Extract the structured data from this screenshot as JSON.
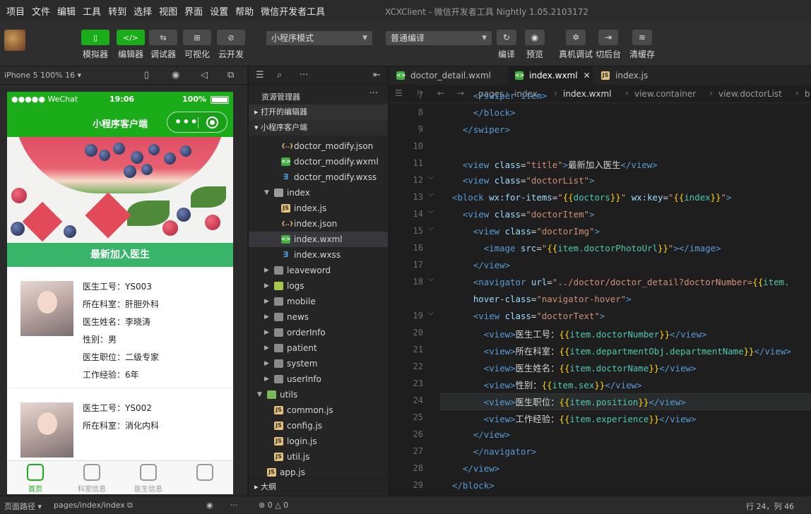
{
  "menu": [
    "项目",
    "文件",
    "编辑",
    "工具",
    "转到",
    "选择",
    "视图",
    "界面",
    "设置",
    "帮助",
    "微信开发者工具"
  ],
  "window_title": "XCXClient - 微信开发者工具 Nightly 1.05.2103172",
  "toolbar": {
    "buttons": [
      {
        "label": "模拟器",
        "icon": "phone-icon"
      },
      {
        "label": "编辑器",
        "icon": "code-icon"
      },
      {
        "label": "调试器",
        "icon": "debug-icon"
      },
      {
        "label": "可视化",
        "icon": "layout-icon"
      },
      {
        "label": "云开发",
        "icon": "cloud-icon"
      }
    ],
    "mode_select": "小程序模式",
    "compile_select": "普通编译",
    "right_buttons": [
      {
        "label": "编译",
        "icon": "refresh-icon"
      },
      {
        "label": "预览",
        "icon": "eye-icon"
      },
      {
        "label": "真机调试",
        "icon": "bug-icon"
      },
      {
        "label": "切后台",
        "icon": "switch-icon"
      },
      {
        "label": "清缓存",
        "icon": "layers-icon"
      }
    ]
  },
  "simulator": {
    "device": "iPhone 5 100% 16 ▾",
    "status": {
      "carrier": "●●●●● WeChat",
      "time": "19:06",
      "battery": "100%"
    },
    "nav_title": "小程序客户端",
    "section_title": "最新加入医生",
    "doctors": [
      {
        "lines": [
          "医生工号：YS003",
          "所在科室：肝胆外科",
          "医生姓名：李晓涛",
          "性别：男",
          "医生职位：二级专家",
          "工作经验：6年"
        ]
      },
      {
        "lines": [
          "医生工号：YS002",
          "所在科室：消化内科"
        ]
      }
    ],
    "tabs": [
      "首页",
      "科室信息",
      "医生信息",
      ""
    ]
  },
  "explorer": {
    "title": "资源管理器",
    "section_open": "打开的编辑器",
    "section_project": "小程序客户端",
    "items": [
      {
        "name": "doctor_modify.json",
        "type": "json",
        "indent": 2
      },
      {
        "name": "doctor_modify.wxml",
        "type": "wxml",
        "indent": 2
      },
      {
        "name": "doctor_modify.wxss",
        "type": "wxss",
        "indent": 2
      },
      {
        "name": "index",
        "type": "folder-open",
        "indent": 1
      },
      {
        "name": "index.js",
        "type": "js",
        "indent": 2
      },
      {
        "name": "index.json",
        "type": "json",
        "indent": 2
      },
      {
        "name": "index.wxml",
        "type": "wxml",
        "indent": 2,
        "selected": true
      },
      {
        "name": "index.wxss",
        "type": "wxss",
        "indent": 2
      },
      {
        "name": "leaveword",
        "type": "folder",
        "indent": 1
      },
      {
        "name": "logs",
        "type": "logsfolder",
        "indent": 1
      },
      {
        "name": "mobile",
        "type": "folder",
        "indent": 1
      },
      {
        "name": "news",
        "type": "folder",
        "indent": 1
      },
      {
        "name": "orderInfo",
        "type": "folder",
        "indent": 1
      },
      {
        "name": "patient",
        "type": "folder",
        "indent": 1
      },
      {
        "name": "system",
        "type": "folder",
        "indent": 1
      },
      {
        "name": "userInfo",
        "type": "folder",
        "indent": 1
      },
      {
        "name": "utils",
        "type": "utils-open",
        "indent": 0
      },
      {
        "name": "common.js",
        "type": "js",
        "indent": 1
      },
      {
        "name": "config.js",
        "type": "js",
        "indent": 1
      },
      {
        "name": "login.js",
        "type": "js",
        "indent": 1
      },
      {
        "name": "util.js",
        "type": "js",
        "indent": 1
      },
      {
        "name": "app.js",
        "type": "js",
        "indent": 0
      }
    ],
    "outline": "大纲"
  },
  "editor": {
    "tabs": [
      {
        "name": "doctor_detail.wxml",
        "type": "wxml"
      },
      {
        "name": "index.wxml",
        "type": "wxml",
        "active": true
      },
      {
        "name": "index.js",
        "type": "js"
      }
    ],
    "breadcrumb": [
      "pages",
      "index",
      "index.wxml",
      "view.container",
      "view.doctorList",
      "b"
    ],
    "current_line": 24,
    "lines": [
      {
        "n": 7,
        "tokens": [
          [
            "tx",
            "    "
          ],
          [
            "tg",
            "</swiper-item>"
          ]
        ]
      },
      {
        "n": 8,
        "tokens": [
          [
            "tx",
            "    "
          ],
          [
            "tg",
            "</block>"
          ]
        ]
      },
      {
        "n": 9,
        "tokens": [
          [
            "tx",
            "  "
          ],
          [
            "tg",
            "</swiper>"
          ]
        ]
      },
      {
        "n": 10,
        "tokens": []
      },
      {
        "n": 11,
        "tokens": [
          [
            "tx",
            "  "
          ],
          [
            "tg",
            "<view "
          ],
          [
            "at",
            "class"
          ],
          [
            "tx",
            "="
          ],
          [
            "sv",
            "\"title\""
          ],
          [
            "tg",
            ">"
          ],
          [
            "tx",
            "最新加入医生"
          ],
          [
            "tg",
            "</view>"
          ]
        ]
      },
      {
        "n": 12,
        "fold": true,
        "tokens": [
          [
            "tx",
            "  "
          ],
          [
            "tg",
            "<view "
          ],
          [
            "at",
            "class"
          ],
          [
            "tx",
            "="
          ],
          [
            "sv",
            "\"doctorList\""
          ],
          [
            "tg",
            ">"
          ]
        ]
      },
      {
        "n": 13,
        "fold": true,
        "tokens": [
          [
            "tg",
            "<block "
          ],
          [
            "at",
            "wx:for-items"
          ],
          [
            "tx",
            "="
          ],
          [
            "sv",
            "\""
          ],
          [
            "br",
            "{{"
          ],
          [
            "vr",
            "doctors"
          ],
          [
            "br",
            "}}"
          ],
          [
            "sv",
            "\""
          ],
          [
            "tx",
            " "
          ],
          [
            "at",
            "wx:key"
          ],
          [
            "tx",
            "="
          ],
          [
            "sv",
            "\""
          ],
          [
            "br",
            "{{"
          ],
          [
            "vr",
            "index"
          ],
          [
            "br",
            "}}"
          ],
          [
            "sv",
            "\""
          ],
          [
            "tg",
            ">"
          ]
        ]
      },
      {
        "n": 14,
        "fold": true,
        "tokens": [
          [
            "tx",
            "  "
          ],
          [
            "tg",
            "<view "
          ],
          [
            "at",
            "class"
          ],
          [
            "tx",
            "="
          ],
          [
            "sv",
            "\"doctorItem\""
          ],
          [
            "tg",
            ">"
          ]
        ]
      },
      {
        "n": 15,
        "fold": true,
        "tokens": [
          [
            "tx",
            "    "
          ],
          [
            "tg",
            "<view "
          ],
          [
            "at",
            "class"
          ],
          [
            "tx",
            "="
          ],
          [
            "sv",
            "\"doctorImg\""
          ],
          [
            "tg",
            ">"
          ]
        ]
      },
      {
        "n": 16,
        "tokens": [
          [
            "tx",
            "      "
          ],
          [
            "tg",
            "<image "
          ],
          [
            "at",
            "src"
          ],
          [
            "tx",
            "="
          ],
          [
            "sv",
            "\""
          ],
          [
            "br",
            "{{"
          ],
          [
            "vr",
            "item.doctorPhotoUrl"
          ],
          [
            "br",
            "}}"
          ],
          [
            "sv",
            "\""
          ],
          [
            "tg",
            "></image>"
          ]
        ]
      },
      {
        "n": 17,
        "tokens": [
          [
            "tx",
            "    "
          ],
          [
            "tg",
            "</view>"
          ]
        ]
      },
      {
        "n": 18,
        "fold": true,
        "tokens": [
          [
            "tx",
            "    "
          ],
          [
            "tg",
            "<navigator "
          ],
          [
            "at",
            "url"
          ],
          [
            "tx",
            "="
          ],
          [
            "sv",
            "\"../doctor/doctor_detail?doctorNumber="
          ],
          [
            "br",
            "{{"
          ],
          [
            "vr",
            "item."
          ]
        ]
      },
      {
        "n": 0,
        "tokens": [
          [
            "tx",
            "    "
          ],
          [
            "at",
            "hover-class"
          ],
          [
            "tx",
            "="
          ],
          [
            "sv",
            "\"navigator-hover\""
          ],
          [
            "tg",
            ">"
          ]
        ]
      },
      {
        "n": 19,
        "fold": true,
        "tokens": [
          [
            "tx",
            "    "
          ],
          [
            "tg",
            "<view "
          ],
          [
            "at",
            "class"
          ],
          [
            "tx",
            "="
          ],
          [
            "sv",
            "\"doctorText\""
          ],
          [
            "tg",
            ">"
          ]
        ]
      },
      {
        "n": 20,
        "tokens": [
          [
            "tx",
            "      "
          ],
          [
            "tg",
            "<view>"
          ],
          [
            "tx",
            "医生工号："
          ],
          [
            "br",
            "{{"
          ],
          [
            "vr",
            "item.doctorNumber"
          ],
          [
            "br",
            "}}"
          ],
          [
            "tg",
            "</view>"
          ]
        ]
      },
      {
        "n": 21,
        "tokens": [
          [
            "tx",
            "      "
          ],
          [
            "tg",
            "<view>"
          ],
          [
            "tx",
            "所在科室："
          ],
          [
            "br",
            "{{"
          ],
          [
            "vr",
            "item.departmentObj.departmentName"
          ],
          [
            "br",
            "}}"
          ],
          [
            "tg",
            "</view>"
          ]
        ]
      },
      {
        "n": 22,
        "tokens": [
          [
            "tx",
            "      "
          ],
          [
            "tg",
            "<view>"
          ],
          [
            "tx",
            "医生姓名："
          ],
          [
            "br",
            "{{"
          ],
          [
            "vr",
            "item.doctorName"
          ],
          [
            "br",
            "}}"
          ],
          [
            "tg",
            "</view>"
          ]
        ]
      },
      {
        "n": 23,
        "tokens": [
          [
            "tx",
            "      "
          ],
          [
            "tg",
            "<view>"
          ],
          [
            "tx",
            "性别："
          ],
          [
            "br",
            "{{"
          ],
          [
            "vr",
            "item.sex"
          ],
          [
            "br",
            "}}"
          ],
          [
            "tg",
            "</view>"
          ]
        ]
      },
      {
        "n": 24,
        "tokens": [
          [
            "tx",
            "      "
          ],
          [
            "tg",
            "<view>"
          ],
          [
            "tx",
            "医生职位："
          ],
          [
            "br",
            "{{"
          ],
          [
            "vr",
            "item.position"
          ],
          [
            "br",
            "}}"
          ],
          [
            "tg",
            "</view>"
          ]
        ]
      },
      {
        "n": 25,
        "tokens": [
          [
            "tx",
            "      "
          ],
          [
            "tg",
            "<view>"
          ],
          [
            "tx",
            "工作经验："
          ],
          [
            "br",
            "{{"
          ],
          [
            "vr",
            "item.experience"
          ],
          [
            "br",
            "}}"
          ],
          [
            "tg",
            "</view>"
          ]
        ]
      },
      {
        "n": 26,
        "tokens": [
          [
            "tx",
            "    "
          ],
          [
            "tg",
            "</view>"
          ]
        ]
      },
      {
        "n": 27,
        "tokens": [
          [
            "tx",
            "    "
          ],
          [
            "tg",
            "</navigator>"
          ]
        ]
      },
      {
        "n": 28,
        "tokens": [
          [
            "tx",
            "  "
          ],
          [
            "tg",
            "</view>"
          ]
        ]
      },
      {
        "n": 29,
        "tokens": [
          [
            "tg",
            "</block>"
          ]
        ]
      }
    ]
  },
  "statusbar": {
    "page_path_label": "页面路径 ▾",
    "page_path": "pages/index/index",
    "errors": "⊗ 0 △ 0",
    "position": "行 24，列 46"
  }
}
